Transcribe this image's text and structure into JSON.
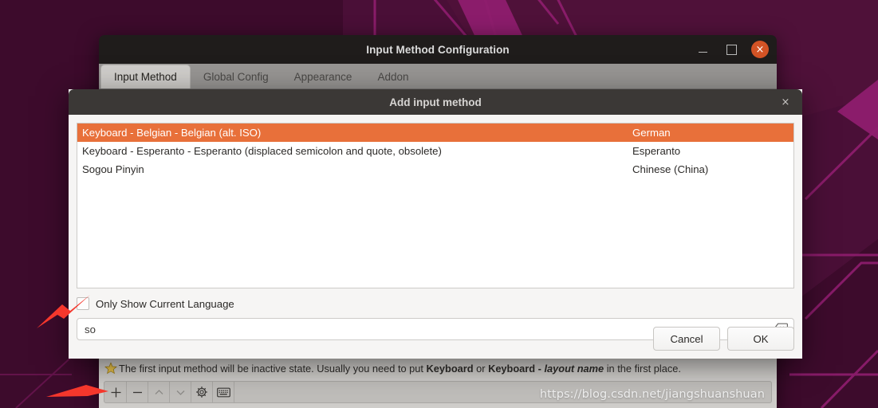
{
  "desktop": {
    "background_color": "#3d0b2c",
    "accent_line_color": "#8e1d6e"
  },
  "main_window": {
    "title": "Input Method Configuration",
    "controls": {
      "minimize": "minimize-icon",
      "maximize": "maximize-icon",
      "close": "×"
    },
    "tabs": [
      {
        "label": "Input Method",
        "active": true
      },
      {
        "label": "Global Config",
        "active": false
      },
      {
        "label": "Appearance",
        "active": false
      },
      {
        "label": "Addon",
        "active": false
      }
    ],
    "hint": {
      "icon": "star-icon",
      "prefix": "The first input method will be inactive state. Usually you need to put ",
      "bold1": "Keyboard",
      "middle": " or ",
      "bold2": "Keyboard - ",
      "italic": "layout name",
      "suffix": " in the first place."
    },
    "toolbar": [
      {
        "name": "add-button",
        "glyph": "+",
        "enabled": true
      },
      {
        "name": "remove-button",
        "glyph": "−",
        "enabled": true
      },
      {
        "name": "move-up-button",
        "glyph": "⌃",
        "enabled": false
      },
      {
        "name": "move-down-button",
        "glyph": "⌄",
        "enabled": false
      },
      {
        "name": "configure-button",
        "glyph": "gear-icon",
        "enabled": true
      },
      {
        "name": "keyboard-layout-button",
        "glyph": "keyboard-icon",
        "enabled": true
      }
    ],
    "watermark": "https://blog.csdn.net/jiangshuanshuan"
  },
  "dialog": {
    "title": "Add input method",
    "close_label": "×",
    "list": [
      {
        "name": "Keyboard - Belgian - Belgian (alt. ISO)",
        "language": "German",
        "selected": true
      },
      {
        "name": "Keyboard - Esperanto - Esperanto (displaced semicolon and quote, obsolete)",
        "language": "Esperanto",
        "selected": false
      },
      {
        "name": "Sogou Pinyin",
        "language": "Chinese (China)",
        "selected": false
      }
    ],
    "checkbox": {
      "label": "Only Show Current Language",
      "checked": false
    },
    "search": {
      "value": "so",
      "placeholder": "",
      "clear_icon": "backspace-clear-icon"
    },
    "buttons": {
      "cancel": "Cancel",
      "ok": "OK"
    }
  },
  "annotations": {
    "arrow_color": "#f5372c",
    "arrows": [
      {
        "name": "arrow-to-checkbox",
        "target": "only-show-current-language-checkbox"
      },
      {
        "name": "arrow-to-add-button",
        "target": "add-button"
      }
    ]
  }
}
